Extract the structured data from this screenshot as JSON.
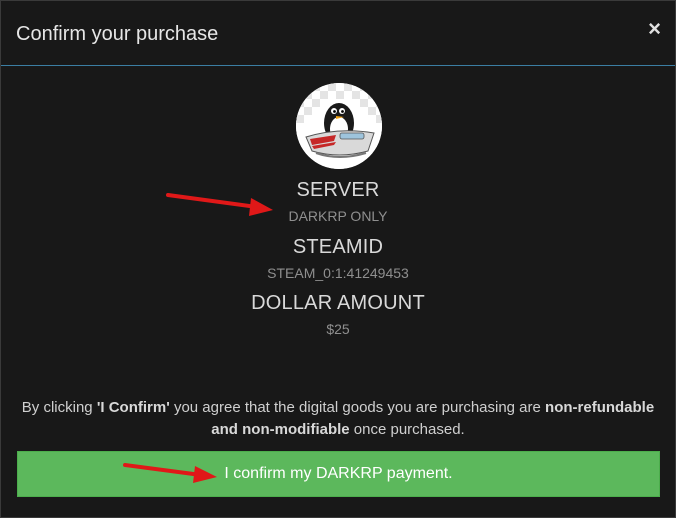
{
  "modal": {
    "title": "Confirm your purchase",
    "close_glyph": "×"
  },
  "avatar": {
    "icon": "penguin-avatar-icon"
  },
  "details": {
    "server_label": "SERVER",
    "server_value": "DARKRP ONLY",
    "steamid_label": "STEAMID",
    "steamid_value": "STEAM_0:1:41249453",
    "amount_label": "DOLLAR AMOUNT",
    "amount_value": "$25"
  },
  "notice": {
    "pre": "By clicking ",
    "confirm_term": "'I Confirm'",
    "mid": " you agree that the digital goods you are purchasing are ",
    "terms": "non-refundable and non-modifiable",
    "post": " once purchased."
  },
  "confirm_button": {
    "label": "I confirm my DARKRP payment."
  },
  "colors": {
    "accent_green": "#5cb85c",
    "header_border": "#3b7ea3",
    "annotation_arrow": "#e01818"
  }
}
